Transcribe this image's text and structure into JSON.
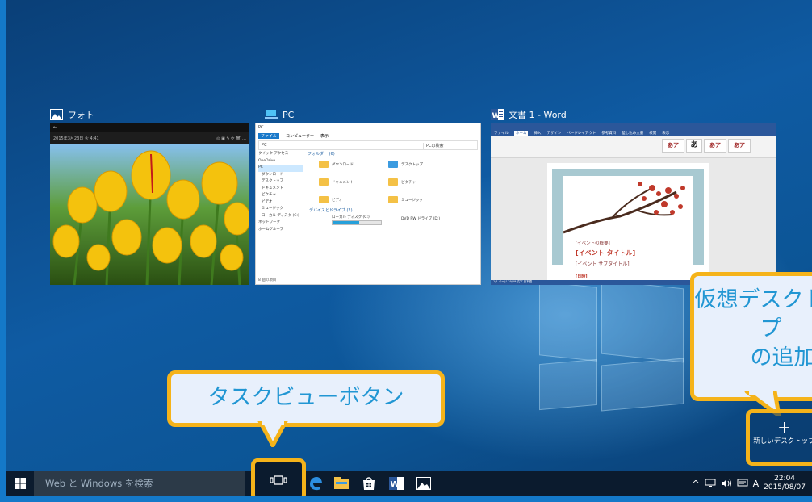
{
  "windows": {
    "photos": {
      "title": "フォト",
      "date_text": "2015年3月23日  火  4:41",
      "icon": "photos-icon"
    },
    "pc": {
      "title": "PC",
      "icon": "pc-icon",
      "window_title": "PC",
      "ribbon_tabs": [
        "ファイル",
        "コンピューター",
        "表示"
      ],
      "address": "PC",
      "search_placeholder": "PCの検索",
      "nav": [
        "クイック アクセス",
        "OneDrive",
        "PC",
        "ダウンロード",
        "デスクトップ",
        "ドキュメント",
        "ピクチャ",
        "ビデオ",
        "ミュージック",
        "ローカル ディスク (C:)",
        "ネットワーク",
        "ホームグループ"
      ],
      "folders_header": "フォルダー (6)",
      "folders": [
        "ダウンロード",
        "デスクトップ",
        "ドキュメント",
        "ピクチャ",
        "ビデオ",
        "ミュージック"
      ],
      "drives_header": "デバイスとドライブ (2)",
      "drives": [
        "ローカル ディスク (C:)",
        "DVD RW ドライブ (D:)"
      ],
      "status": "8 個の項目"
    },
    "word": {
      "title": "文書 1 - Word",
      "icon": "word-icon",
      "tabs": [
        "ファイル",
        "ホーム",
        "挿入",
        "デザイン",
        "ページレイアウト",
        "参考資料",
        "差し込み文書",
        "校閲",
        "表示"
      ],
      "styles": [
        "あア",
        "あ",
        "あア",
        "あア"
      ],
      "lines": [
        "[イベントの概要]",
        "[イベント タイトル]",
        "[イベント サブタイトル]",
        "[日時]"
      ],
      "status": "1/1 ページ   29/29 文字   日本語"
    }
  },
  "callouts": {
    "taskview": "タスクビューボタン",
    "virtual_desktop_line1": "仮想デスクトップ",
    "virtual_desktop_line2": "の追加"
  },
  "new_desktop": {
    "plus": "+",
    "label": "新しいデスクトップ"
  },
  "taskbar": {
    "search_placeholder": "Web と Windows を検索",
    "ime": "A",
    "time": "22:04",
    "date": "2015/08/07"
  },
  "colors": {
    "callout_border": "#f5b31a",
    "callout_text": "#2196d3",
    "taskbar": "#0b1b2e",
    "word_blue": "#2b579a",
    "frame": "#1479c9"
  }
}
